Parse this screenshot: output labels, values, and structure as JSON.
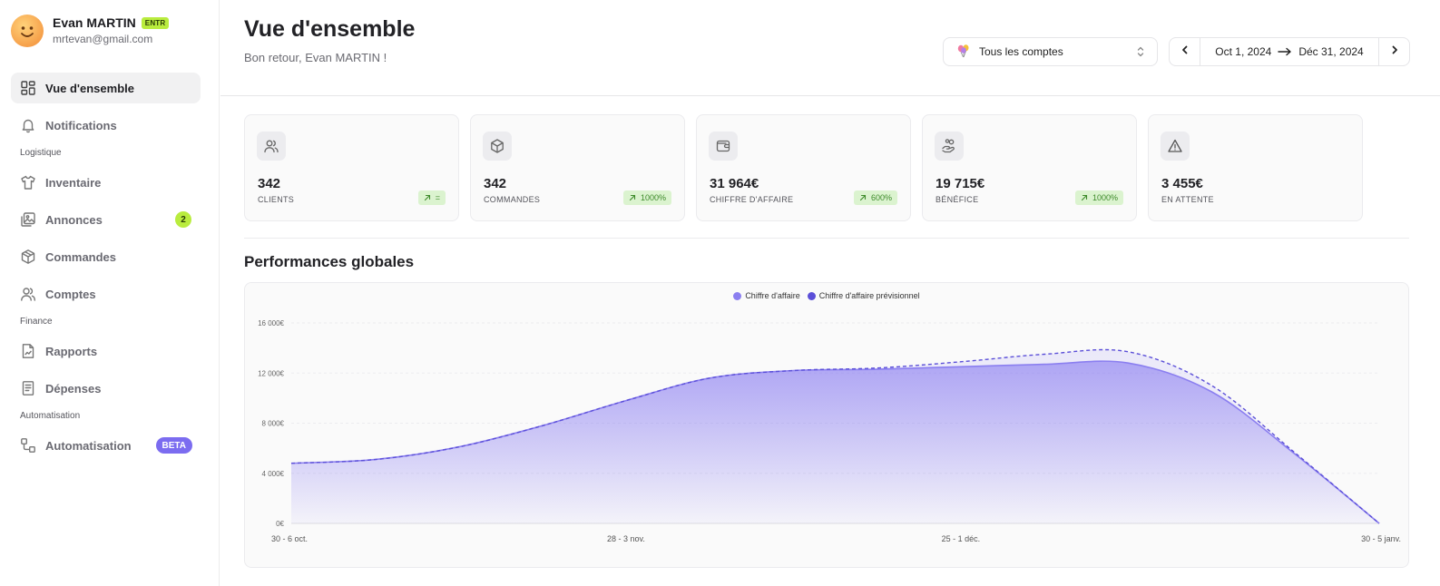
{
  "user": {
    "name": "Evan MARTIN",
    "badge": "ENTR",
    "email": "mrtevan@gmail.com"
  },
  "sidebar": {
    "items": [
      {
        "label": "Vue d'ensemble",
        "icon": "dashboard-grid-icon",
        "active": true
      },
      {
        "label": "Notifications",
        "icon": "bell-icon"
      }
    ],
    "sections": [
      {
        "title": "Logistique",
        "items": [
          {
            "label": "Inventaire",
            "icon": "tshirt-icon"
          },
          {
            "label": "Annonces",
            "icon": "images-icon",
            "badge": "2"
          },
          {
            "label": "Commandes",
            "icon": "package-icon"
          },
          {
            "label": "Comptes",
            "icon": "users-icon"
          }
        ]
      },
      {
        "title": "Finance",
        "items": [
          {
            "label": "Rapports",
            "icon": "chart-file-icon"
          },
          {
            "label": "Dépenses",
            "icon": "receipt-icon"
          }
        ]
      },
      {
        "title": "Automatisation",
        "items": [
          {
            "label": "Automatisation",
            "icon": "workflow-icon",
            "badge": "BETA"
          }
        ]
      }
    ]
  },
  "header": {
    "title": "Vue d'ensemble",
    "subtitle": "Bon retour, Evan MARTIN !",
    "account_select": {
      "value": "Tous les comptes",
      "icon": "balloons-icon"
    },
    "date_range": {
      "start": "Oct 1, 2024",
      "end": "Déc 31, 2024"
    }
  },
  "kpis": [
    {
      "value": "342",
      "label": "CLIENTS",
      "trend": "=",
      "icon": "users-icon"
    },
    {
      "value": "342",
      "label": "COMMANDES",
      "trend": "1000%",
      "icon": "package-icon"
    },
    {
      "value": "31 964€",
      "label": "CHIFFRE D'AFFAIRE",
      "trend": "600%",
      "icon": "wallet-icon"
    },
    {
      "value": "19 715€",
      "label": "BÉNÉFICE",
      "trend": "1000%",
      "icon": "hand-coins-icon"
    },
    {
      "value": "3 455€",
      "label": "EN ATTENTE",
      "trend": "",
      "icon": "warning-icon"
    }
  ],
  "performance": {
    "title": "Performances globales"
  },
  "colors": {
    "accent_lime": "#b9ec3e",
    "accent_purple": "#7b6cf0",
    "series_actual": "#8b7ff0",
    "series_forecast": "#5b4fd8",
    "trend_bg": "#dbf3cf",
    "trend_text": "#3d8a2a"
  },
  "chart_data": {
    "type": "area",
    "categories": [
      "30 - 6 oct.",
      "28 - 3 nov.",
      "25 - 1 déc.",
      "30 - 5 janv."
    ],
    "x_index": [
      0,
      1,
      2,
      3,
      4,
      5,
      6,
      7,
      8,
      9,
      10,
      11,
      12,
      13
    ],
    "x_ticks": [
      0,
      4,
      8,
      13
    ],
    "series": [
      {
        "name": "Chiffre d'affaire",
        "values": [
          4800,
          5100,
          6100,
          7800,
          9800,
          11600,
          12200,
          12300,
          12500,
          12700,
          12800,
          10500,
          5500,
          0
        ]
      },
      {
        "name": "Chiffre d'affaire prévisionnel",
        "values": [
          4800,
          5100,
          6100,
          7800,
          9800,
          11600,
          12200,
          12400,
          12900,
          13500,
          13700,
          11000,
          5600,
          0
        ],
        "style": "dashed"
      }
    ],
    "yticks": [
      0,
      4000,
      8000,
      12000,
      16000
    ],
    "ytick_labels": [
      "0€",
      "4 000€",
      "8 000€",
      "12 000€",
      "16 000€"
    ],
    "ylim": [
      0,
      16000
    ],
    "xlabel": "",
    "ylabel": "",
    "grid": true,
    "legend": "top-center"
  }
}
